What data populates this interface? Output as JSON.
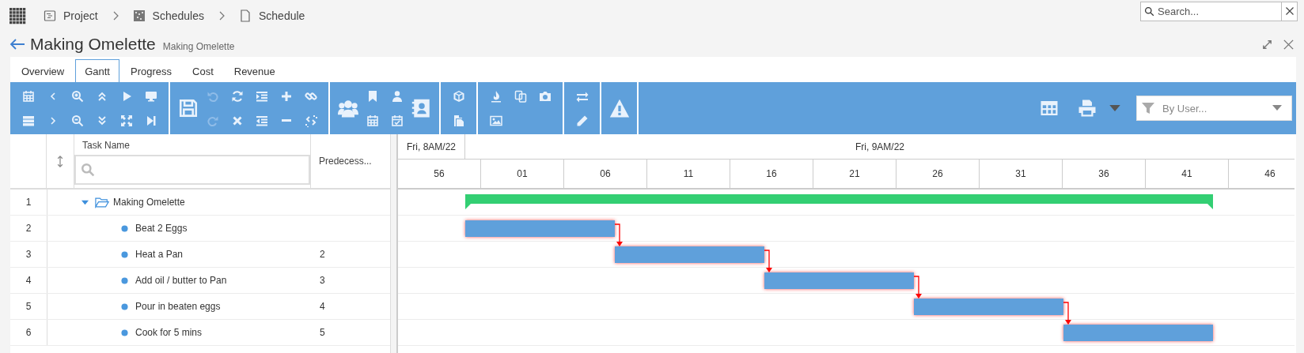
{
  "breadcrumbs": [
    {
      "label": "Project",
      "kind": "project"
    },
    {
      "label": "Schedules",
      "kind": "schedules"
    },
    {
      "label": "Schedule",
      "kind": "schedule"
    }
  ],
  "search": {
    "placeholder": "Search..."
  },
  "title": "Making Omelette",
  "subtitle": "Making Omelette",
  "tabs": [
    {
      "label": "Overview",
      "selected": false
    },
    {
      "label": "Gantt",
      "selected": true
    },
    {
      "label": "Progress",
      "selected": false
    },
    {
      "label": "Cost",
      "selected": false
    },
    {
      "label": "Revenue",
      "selected": false
    }
  ],
  "toolbar": {
    "undo": {
      "disabled": true
    },
    "redo": {
      "disabled": true
    }
  },
  "filter": {
    "placeholder": "By User..."
  },
  "grid": {
    "columns": [
      "Task Name",
      "Predecess..."
    ],
    "rows": [
      {
        "number": "1",
        "kind": "summary",
        "name": "Making Omelette",
        "expanded": true,
        "children": [
          {
            "number": "2",
            "kind": "task",
            "name": "Beat 2 Eggs",
            "critical": true
          },
          {
            "number": "3",
            "kind": "task",
            "name": "Heat a Pan",
            "predecessor": "2",
            "critical": true
          },
          {
            "number": "4",
            "kind": "task",
            "name": "Add oil / butter to Pan",
            "predecessor": "3",
            "critical": true
          },
          {
            "number": "5",
            "kind": "task",
            "name": "Pour in beaten eggs",
            "predecessor": "4",
            "critical": true
          },
          {
            "number": "6",
            "kind": "task",
            "name": "Cook for 5 mins",
            "predecessor": "5",
            "critical": true
          }
        ]
      }
    ]
  },
  "timeline": {
    "top": [
      "Fri, 8AM/22",
      "Fri, 9AM/22"
    ],
    "ticks": [
      "56",
      "01",
      "06",
      "11",
      "16",
      "21",
      "26",
      "31",
      "36",
      "41",
      "46"
    ]
  }
}
